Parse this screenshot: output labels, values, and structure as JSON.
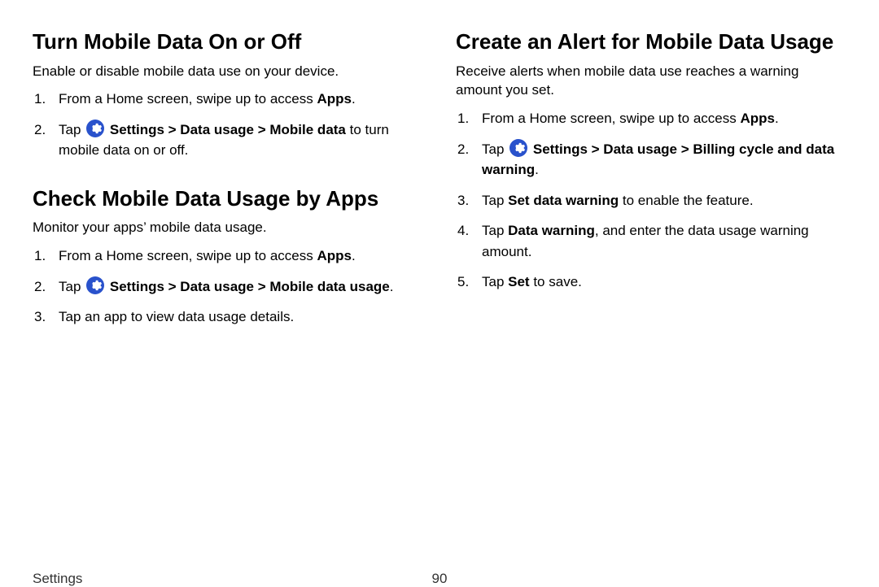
{
  "left": {
    "section1": {
      "heading": "Turn Mobile Data On or Off",
      "intro": "Enable or disable mobile data use on your device.",
      "steps": {
        "s1_pre": "From a Home screen, swipe up to access ",
        "s1_bold": "Apps",
        "s1_post": ".",
        "s2_pre": "Tap ",
        "s2_path": " Settings > Data usage > Mobile data",
        "s2_post": " to turn mobile data on or off."
      }
    },
    "section2": {
      "heading": "Check Mobile Data Usage by Apps",
      "intro": "Monitor your apps’ mobile data usage.",
      "steps": {
        "s1_pre": "From a Home screen, swipe up to access ",
        "s1_bold": "Apps",
        "s1_post": ".",
        "s2_pre": "Tap ",
        "s2_path": " Settings > Data usage > Mobile data usage",
        "s2_post": ".",
        "s3": "Tap an app to view data usage details."
      }
    }
  },
  "right": {
    "section1": {
      "heading": "Create an Alert for Mobile Data Usage",
      "intro": "Receive alerts when mobile data use reaches a warning amount you set.",
      "steps": {
        "s1_pre": "From a Home screen, swipe up to access ",
        "s1_bold": "Apps",
        "s1_post": ".",
        "s2_pre": "Tap ",
        "s2_path": " Settings > Data usage > Billing cycle and data warning",
        "s2_post": ".",
        "s3_pre": "Tap ",
        "s3_bold": "Set data warning",
        "s3_post": " to enable the feature.",
        "s4_pre": "Tap ",
        "s4_bold": "Data warning",
        "s4_post": ", and enter the data usage warning amount.",
        "s5_pre": "Tap ",
        "s5_bold": "Set",
        "s5_post": " to save."
      }
    }
  },
  "footer": {
    "section": "Settings",
    "page": "90"
  },
  "icon": {
    "color": "#2952cc"
  }
}
